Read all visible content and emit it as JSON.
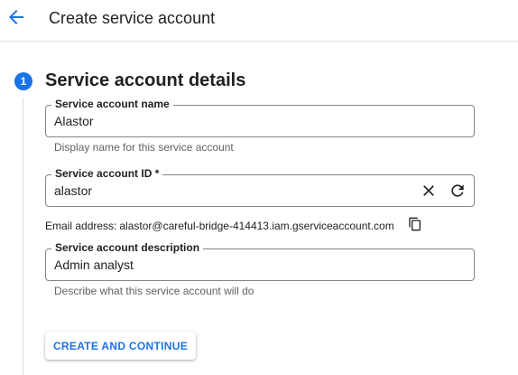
{
  "header": {
    "back_icon": "arrow-left-icon",
    "title": "Create service account"
  },
  "step": {
    "number": "1",
    "title": "Service account details"
  },
  "fields": {
    "name": {
      "label": "Service account name",
      "value": "Alastor",
      "hint": "Display name for this service account"
    },
    "id": {
      "label": "Service account ID *",
      "value": "alastor",
      "clear_icon": "close-icon",
      "regenerate_icon": "refresh-icon"
    },
    "description": {
      "label": "Service account description",
      "value": "Admin analyst",
      "hint": "Describe what this service account will do"
    }
  },
  "email": {
    "label": "Email address:",
    "value": "alastor@careful-bridge-414413.iam.gserviceaccount.com",
    "copy_icon": "copy-icon"
  },
  "actions": {
    "create_continue_label": "CREATE AND CONTINUE"
  },
  "colors": {
    "accent": "#1a73e8",
    "border": "#80868b",
    "hint_text": "#5f6368",
    "divider": "#dadce0"
  }
}
